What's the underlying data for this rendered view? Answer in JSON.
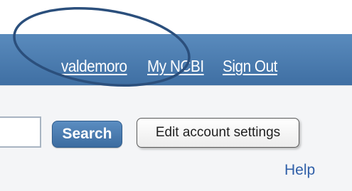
{
  "header": {
    "links": {
      "username": "valdemoro",
      "my_ncbi": "My NCBI",
      "sign_out": "Sign Out"
    },
    "background_color": "#4e7fb2",
    "link_color": "#ffffff"
  },
  "search": {
    "input_value": "",
    "button_label": "Search",
    "button_color": "#4a7cb0"
  },
  "account": {
    "edit_button_label": "Edit account settings",
    "help_link": "Help",
    "help_color": "#2f5fa8"
  },
  "annotation": {
    "shape": "ellipse",
    "color": "#2b4f7c"
  }
}
